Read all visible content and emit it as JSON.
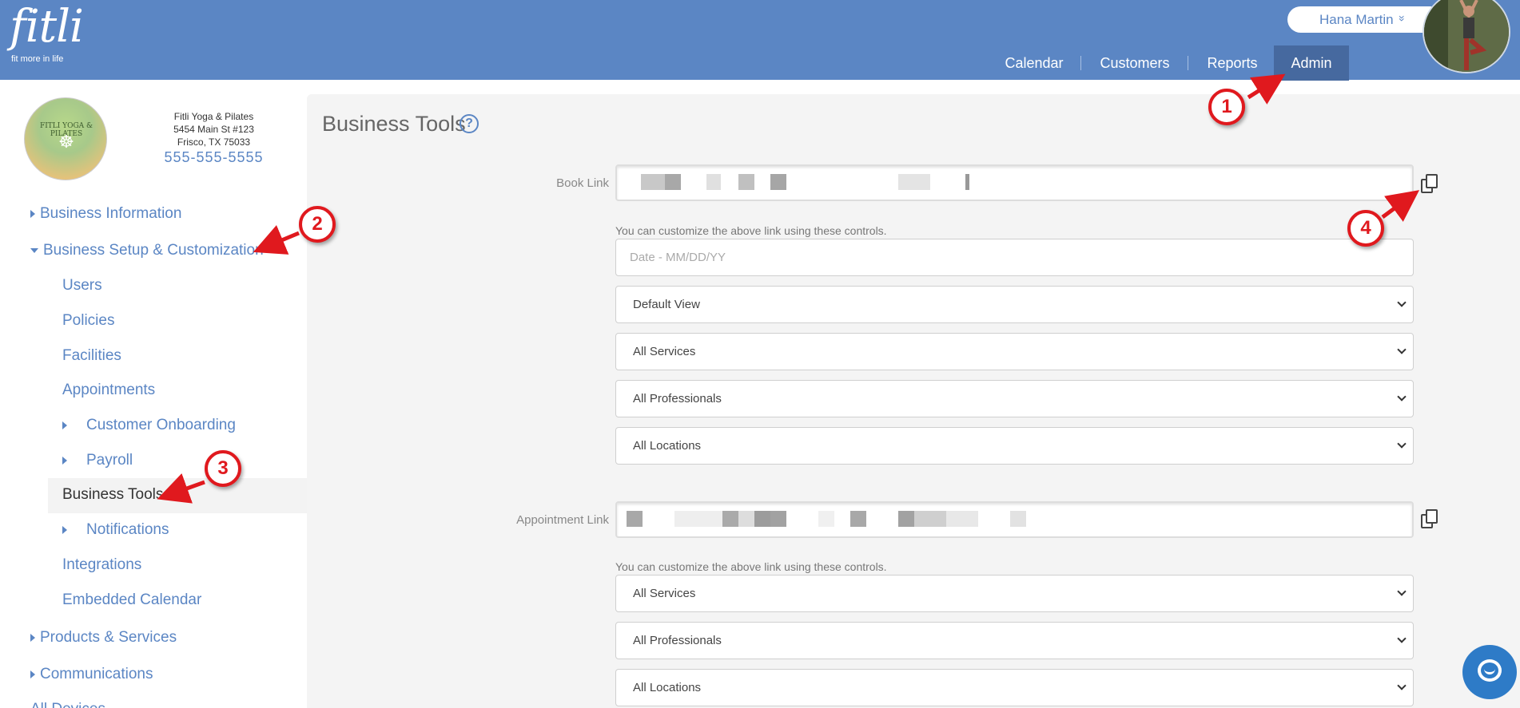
{
  "header": {
    "logo_word": "fitli",
    "logo_tagline": "fit more in life",
    "user_name": "Hana Martin",
    "user_menu_chevron": "»",
    "nav": [
      {
        "label": "Calendar"
      },
      {
        "label": "Customers"
      },
      {
        "label": "Reports"
      },
      {
        "label": "Admin",
        "active": true
      }
    ]
  },
  "business": {
    "logo_text": "FITLI YOGA & PILATES",
    "name": "Fitli Yoga & Pilates",
    "address1": "5454 Main St #123",
    "address2": "Frisco, TX 75033",
    "phone": "555-555-5555"
  },
  "sidebar": {
    "items": [
      {
        "label": "Business Information"
      },
      {
        "label": "Business Setup & Customization"
      },
      {
        "label": "Users"
      },
      {
        "label": "Policies"
      },
      {
        "label": "Facilities"
      },
      {
        "label": "Appointments"
      },
      {
        "label": "Customer Onboarding"
      },
      {
        "label": "Payroll"
      },
      {
        "label": "Business Tools"
      },
      {
        "label": "Notifications"
      },
      {
        "label": "Integrations"
      },
      {
        "label": "Embedded Calendar"
      },
      {
        "label": "Products & Services"
      },
      {
        "label": "Communications"
      },
      {
        "label": "All Devices"
      }
    ]
  },
  "main": {
    "title": "Business Tools",
    "help_icon_glyph": "?",
    "book_link": {
      "label": "Book Link",
      "hint": "You can customize the above link using these controls.",
      "date_placeholder": "Date - MM/DD/YY",
      "view_select": "Default View",
      "services_select": "All Services",
      "professionals_select": "All Professionals",
      "locations_select": "All Locations"
    },
    "appointment_link": {
      "label": "Appointment Link",
      "hint": "You can customize the above link using these controls.",
      "services_select": "All Services",
      "professionals_select": "All Professionals",
      "locations_select": "All Locations"
    }
  },
  "annotations": {
    "badges": [
      "1",
      "2",
      "3",
      "4"
    ],
    "color": "#e0191e"
  },
  "colors": {
    "header_bg": "#5b86c4",
    "nav_active_bg": "#46699f",
    "link_color": "#5b86c4",
    "main_bg": "#f4f4f4",
    "chat_button": "#2e7bc7"
  }
}
